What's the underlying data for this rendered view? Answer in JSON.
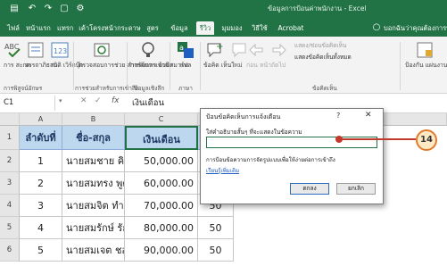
{
  "window": {
    "title": "ข้อมูลการป้อนค่าพนักงาน - Excel"
  },
  "tabs": {
    "file": "ไฟล์",
    "home": "หน้าแรก",
    "insert": "แทรก",
    "page_layout": "เค้าโครงหน้ากระดาษ",
    "formulas": "สูตร",
    "data": "ข้อมูล",
    "review": "รีวิว",
    "view": "มุมมอง",
    "help": "วิธีใช้",
    "acrobat": "Acrobat",
    "tell_me": "บอกฉันว่าคุณต้องการทำอะไร"
  },
  "ribbon": {
    "spelling": "การ สะกด",
    "thesaurus": "อรรถาภิธาน",
    "stats": "สถิติ เวิร์กบุ๊ก",
    "proofing_group": "การพิสูจน์อักษร",
    "accessibility": "ตรวจสอบการช่วย สำหรับการเข้าถึง",
    "accessibility_group": "การช่วยสำหรับการเข้าถึง",
    "smart_lookup": "การค้นหา แบบสมาร์ท",
    "insights_group": "ข้อมูลเชิงลึก",
    "translate": "แปล",
    "language_group": "ภาษา",
    "new_comment": "ข้อคิด เห็นใหม่",
    "delete_comment": "ลบ",
    "prev_comment": "ก่อน หน้า",
    "next_comment": "ถัดไป",
    "comments_group": "ข้อคิดเห็น",
    "show_hide_comment": "แสดง/ซ่อนข้อคิดเห็น",
    "show_all_comments": "แสดงข้อคิดเห็นทั้งหมด",
    "protect": "ป้องกัน แผ่นงาน"
  },
  "formula_bar": {
    "name_box": "C1",
    "fx": "fx",
    "content": "เงินเดือน"
  },
  "grid": {
    "columns": [
      "A",
      "B",
      "C"
    ],
    "row_numbers": [
      "1",
      "2",
      "3",
      "4",
      "5",
      "6"
    ],
    "header_row": [
      "ลำดับที่",
      "ชื่อ-สกุล",
      "เงินเดือน",
      ""
    ],
    "rows": [
      [
        "1",
        "นายสมชาย คิดดี",
        "50,000.00",
        "50"
      ],
      [
        "2",
        "นายสมทรง พูดดี",
        "60,000.00",
        "50"
      ],
      [
        "3",
        "นายสมจิต ทำดี",
        "70,000.00",
        "50"
      ],
      [
        "4",
        "นายสมรักษ์ รักดี",
        "80,000.00",
        "50"
      ],
      [
        "5",
        "นายสมเจต ชอบดี",
        "90,000.00",
        "50"
      ]
    ]
  },
  "dialog": {
    "title": "ป้อนข้อคิดเห็นการแจ้งเตือน",
    "help": "?",
    "close": "✕",
    "prompt": "ใส่คำอธิบายสั้นๆ ที่จะแสดงในข้อความ",
    "input_value": "",
    "description": "การป้อนข้อความการจัดรูปแบบเพื่อให้ง่ายต่อการเข้าถึง",
    "link": "เรียนรู้เพิ่มเติม",
    "ok": "ตกลง",
    "cancel": "ยกเลิก"
  },
  "callout": {
    "number": "14"
  },
  "colors": {
    "excel_green": "#217346",
    "header_fill": "#bdd7ee",
    "callout_red": "#c0392b",
    "callout_fill": "#fde9c4"
  }
}
